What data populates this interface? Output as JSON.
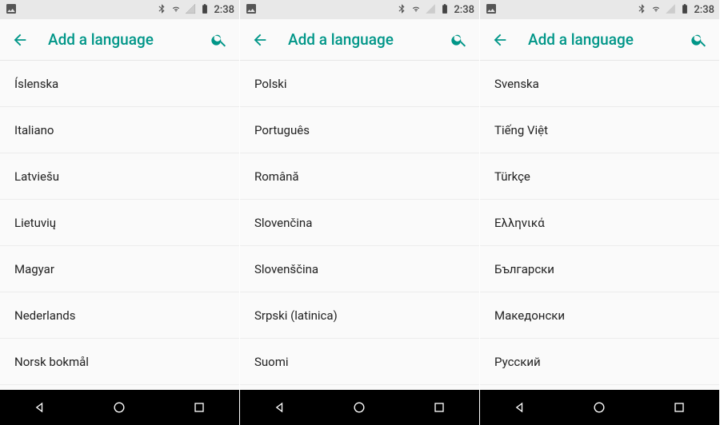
{
  "status": {
    "time": "2:38"
  },
  "header": {
    "title": "Add a language"
  },
  "panes": [
    {
      "items": [
        "Íslenska",
        "Italiano",
        "Latviešu",
        "Lietuvių",
        "Magyar",
        "Nederlands",
        "Norsk bokmål"
      ]
    },
    {
      "items": [
        "Polski",
        "Português",
        "Română",
        "Slovenčina",
        "Slovenščina",
        "Srpski (latinica)",
        "Suomi"
      ]
    },
    {
      "items": [
        "Svenska",
        "Tiếng Việt",
        "Türkçe",
        "Ελληνικά",
        "Български",
        "Македонски",
        "Русский"
      ]
    }
  ]
}
